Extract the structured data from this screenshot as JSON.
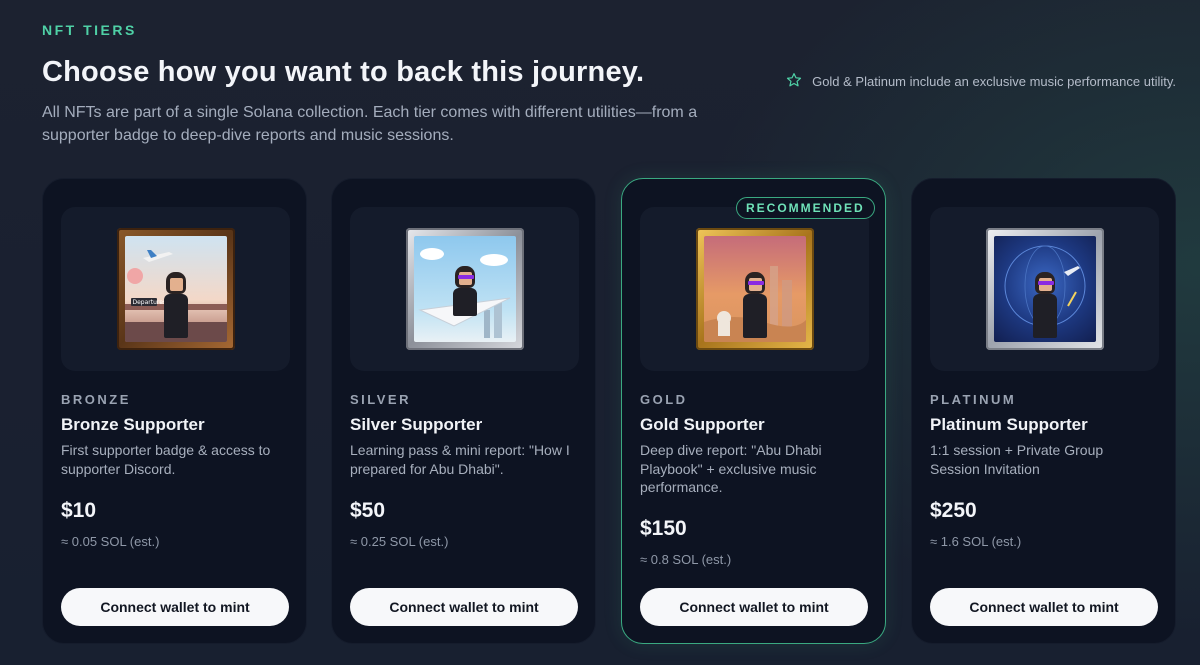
{
  "header": {
    "eyebrow": "NFT TIERS",
    "title": "Choose how you want to back this journey.",
    "subtitle": "All NFTs are part of a single Solana collection. Each tier comes with different utilities—from a supporter badge to deep-dive reports and music sessions.",
    "note": "Gold & Platinum include an exclusive music performance utility.",
    "note_icon": "star-icon"
  },
  "colors": {
    "accent": "#4fd1a6",
    "card_bg": "#0d1322",
    "button_bg": "#f7f8fa"
  },
  "tiers": [
    {
      "tier": "BRONZE",
      "name": "Bronze Supporter",
      "description": "First supporter badge & access to supporter Discord.",
      "price": "$10",
      "sol": "≈ 0.05 SOL (est.)",
      "button": "Connect wallet to mint",
      "art_sign": "Departures"
    },
    {
      "tier": "SILVER",
      "name": "Silver Supporter",
      "description": "Learning pass & mini report: \"How I prepared for Abu Dhabi\".",
      "price": "$50",
      "sol": "≈ 0.25 SOL (est.)",
      "button": "Connect wallet to mint"
    },
    {
      "tier": "GOLD",
      "name": "Gold Supporter",
      "description": "Deep dive report: \"Abu Dhabi Playbook\" + exclusive music performance.",
      "price": "$150",
      "sol": "≈ 0.8 SOL (est.)",
      "button": "Connect wallet to mint",
      "badge": "RECOMMENDED"
    },
    {
      "tier": "PLATINUM",
      "name": "Platinum Supporter",
      "description": "1:1 session + Private Group Session Invitation",
      "price": "$250",
      "sol": "≈ 1.6 SOL (est.)",
      "button": "Connect wallet to mint"
    }
  ]
}
